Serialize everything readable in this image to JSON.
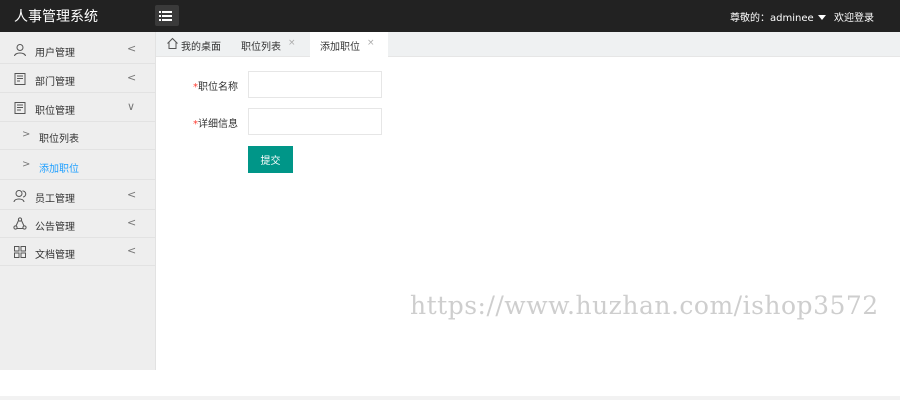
{
  "header": {
    "title": "人事管理系统",
    "menu_toggle_icon": "list-icon",
    "greeting": "尊敬的：adminee",
    "logout": "欢迎登录"
  },
  "sidebar": {
    "items": [
      {
        "label": "用户管理",
        "icon": "user-icon",
        "arrow": "<"
      },
      {
        "label": "部门管理",
        "icon": "building-icon",
        "arrow": "<"
      },
      {
        "label": "职位管理",
        "icon": "position-icon",
        "arrow": "∨",
        "expanded": true
      },
      {
        "label": "员工管理",
        "icon": "people-icon",
        "arrow": "<"
      },
      {
        "label": "公告管理",
        "icon": "notice-icon",
        "arrow": "<"
      },
      {
        "label": "文档管理",
        "icon": "grid-icon",
        "arrow": "<"
      }
    ],
    "subitems": [
      {
        "label": "职位列表",
        "arrow": ">"
      },
      {
        "label": "添加职位",
        "arrow": ">",
        "active": true
      }
    ]
  },
  "tabs": [
    {
      "label": "我的桌面",
      "icon": "home-icon"
    },
    {
      "label": "职位列表",
      "close": "×"
    },
    {
      "label": "添加职位",
      "close": "×",
      "active": true
    }
  ],
  "form": {
    "required_mark": "*",
    "position_name_label": "职位名称",
    "position_name_value": "",
    "detail_label": "详细信息",
    "detail_value": "",
    "submit_label": "提交"
  },
  "watermark": "https://www.huzhan.com/ishop3572",
  "colors": {
    "header_bg": "#222222",
    "sidebar_bg": "#eeeeee",
    "submit_bg": "#009688",
    "active_link": "#1e9fff",
    "required": "#ff3b30"
  }
}
